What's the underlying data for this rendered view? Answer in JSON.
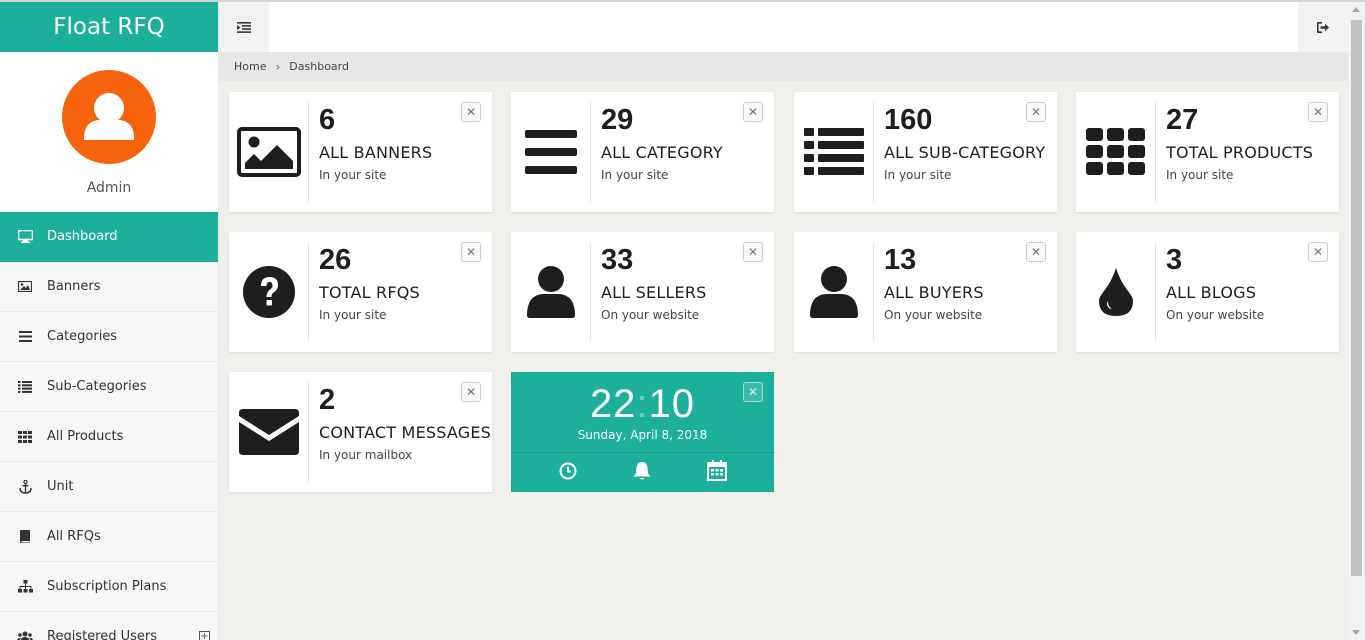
{
  "brand": "Float RFQ",
  "profile": {
    "name": "Admin"
  },
  "menu": [
    {
      "label": "Dashboard",
      "icon": "monitor-icon",
      "active": true
    },
    {
      "label": "Banners",
      "icon": "image-icon"
    },
    {
      "label": "Categories",
      "icon": "list-icon"
    },
    {
      "label": "Sub-Categories",
      "icon": "list-bullets-icon"
    },
    {
      "label": "All Products",
      "icon": "grid-icon"
    },
    {
      "label": "Unit",
      "icon": "anchor-icon"
    },
    {
      "label": "All RFQs",
      "icon": "book-icon"
    },
    {
      "label": "Subscription Plans",
      "icon": "sitemap-icon"
    },
    {
      "label": "Registered Users",
      "icon": "users-icon",
      "expandable": true
    }
  ],
  "breadcrumb": {
    "home": "Home",
    "current": "Dashboard"
  },
  "widgets": [
    {
      "count": "6",
      "title": "ALL BANNERS",
      "sub": "In your site",
      "icon": "picture-icon"
    },
    {
      "count": "29",
      "title": "ALL CATEGORY",
      "sub": "In your site",
      "icon": "bars-icon"
    },
    {
      "count": "160",
      "title": "ALL SUB-CATEGORY",
      "sub": "In your site",
      "icon": "list-icon"
    },
    {
      "count": "27",
      "title": "TOTAL PRODUCTS",
      "sub": "In your site",
      "icon": "grid-icon"
    },
    {
      "count": "26",
      "title": "TOTAL RFQS",
      "sub": "In your site",
      "icon": "question-circle-icon"
    },
    {
      "count": "33",
      "title": "ALL SELLERS",
      "sub": "On your website",
      "icon": "user-icon"
    },
    {
      "count": "13",
      "title": "ALL BUYERS",
      "sub": "On your website",
      "icon": "user-icon"
    },
    {
      "count": "3",
      "title": "ALL BLOGS",
      "sub": "On your website",
      "icon": "droplet-icon"
    },
    {
      "count": "2",
      "title": "CONTACT MESSAGES",
      "sub": "In your mailbox",
      "icon": "envelope-icon"
    }
  ],
  "clock": {
    "hours": "22",
    "minutes": "10",
    "date": "Sunday, April 8, 2018"
  },
  "close_symbol": "✕",
  "colors": {
    "accent": "#1caf9a",
    "avatar": "#f7630c"
  }
}
